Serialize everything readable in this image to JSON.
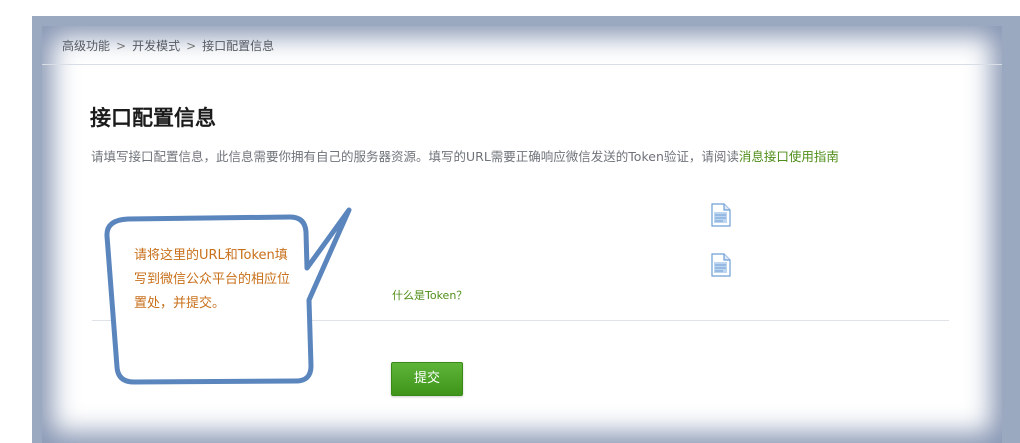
{
  "breadcrumb": {
    "items": [
      "高级功能",
      "开发模式",
      "接口配置信息"
    ],
    "separator": ">"
  },
  "page": {
    "title": "接口配置信息",
    "description": "请填写接口配置信息，此信息需要你拥有自己的服务器资源。填写的URL需要正确响应微信发送的Token验证，请阅读",
    "guide_link": "消息接口使用指南"
  },
  "form": {
    "token_help_link": "什么是Token？",
    "submit_label": "提交"
  },
  "callout": {
    "text": "请将这里的URL和Token填写到微信公众平台的相应位置处，并提交。"
  },
  "colors": {
    "accent_green": "#4f8e18",
    "callout_text": "#c8701a",
    "callout_border": "#5b86bd"
  },
  "icons": [
    "document-icon",
    "document-icon"
  ]
}
